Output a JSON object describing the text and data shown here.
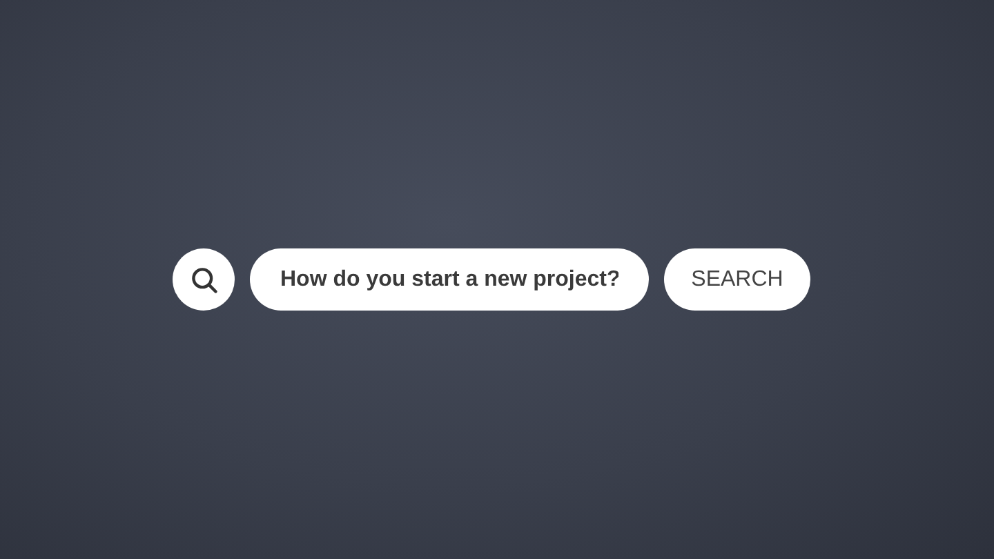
{
  "search": {
    "value": "How do you start a new project?",
    "button": "SEARCH"
  }
}
